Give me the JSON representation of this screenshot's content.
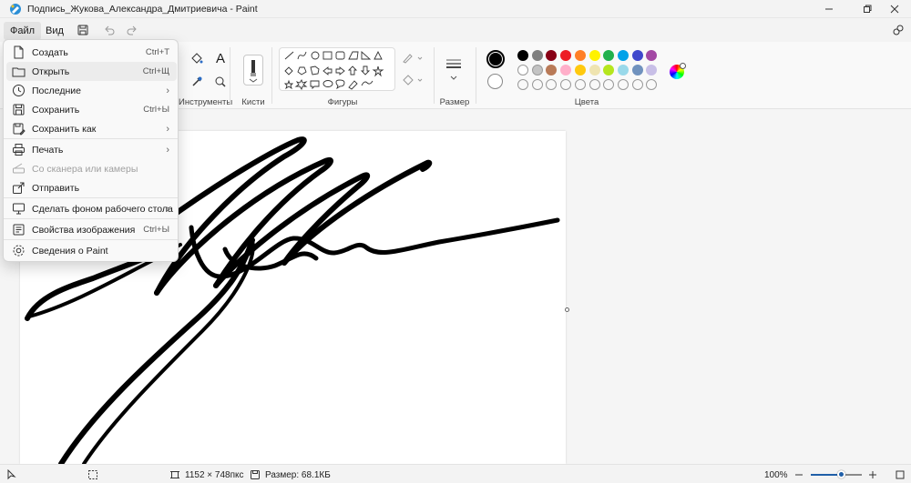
{
  "window": {
    "title": "Подпись_Жукова_Александра_Дмитриевича - Paint"
  },
  "menubar": {
    "file": "Файл",
    "view": "Вид"
  },
  "ribbon": {
    "groups": {
      "tools": "Инструменты",
      "brushes": "Кисти",
      "shapes": "Фигуры",
      "size": "Размер",
      "colors": "Цвета"
    },
    "text_tool": "A"
  },
  "colors": {
    "primary": "#000000",
    "secondary": "#ffffff",
    "row1": [
      "#000000",
      "#7f7f7f",
      "#880015",
      "#ed1c24",
      "#ff7f27",
      "#fff200",
      "#22b14c",
      "#00a2e8",
      "#3f48cc",
      "#a349a4"
    ],
    "row2": [
      "#ffffff",
      "#c3c3c3",
      "#b97a57",
      "#ffaec9",
      "#ffc90e",
      "#efe4b0",
      "#b5e61d",
      "#99d9ea",
      "#7092be",
      "#c8bfe7"
    ],
    "row3_empty_count": 10
  },
  "file_menu": {
    "items": [
      {
        "label": "Создать",
        "shortcut": "Ctrl+T",
        "icon": "new-file-icon"
      },
      {
        "label": "Открыть",
        "shortcut": "Ctrl+Щ",
        "icon": "folder-icon"
      },
      {
        "label": "Последние",
        "shortcut": "",
        "icon": "clock-icon"
      },
      {
        "label": "Сохранить",
        "shortcut": "Ctrl+Ы",
        "icon": "save-icon"
      },
      {
        "label": "Сохранить как",
        "shortcut": "",
        "icon": "save-as-icon"
      },
      {
        "label": "Печать",
        "shortcut": "",
        "icon": "printer-icon"
      },
      {
        "label": "Со сканера или камеры",
        "shortcut": "",
        "icon": "scanner-icon"
      },
      {
        "label": "Отправить",
        "shortcut": "",
        "icon": "share-icon"
      },
      {
        "label": "Сделать фоном рабочего стола",
        "shortcut": "",
        "icon": "desktop-icon"
      },
      {
        "label": "Свойства изображения",
        "shortcut": "Ctrl+Ы",
        "icon": "properties-icon"
      },
      {
        "label": "Сведения о Paint",
        "shortcut": "",
        "icon": "gear-icon"
      }
    ]
  },
  "status": {
    "dimensions": "1152 × 748пкс",
    "size": "Размер: 68.1КБ",
    "zoom": "100%",
    "zoom_fraction": 0.6
  }
}
